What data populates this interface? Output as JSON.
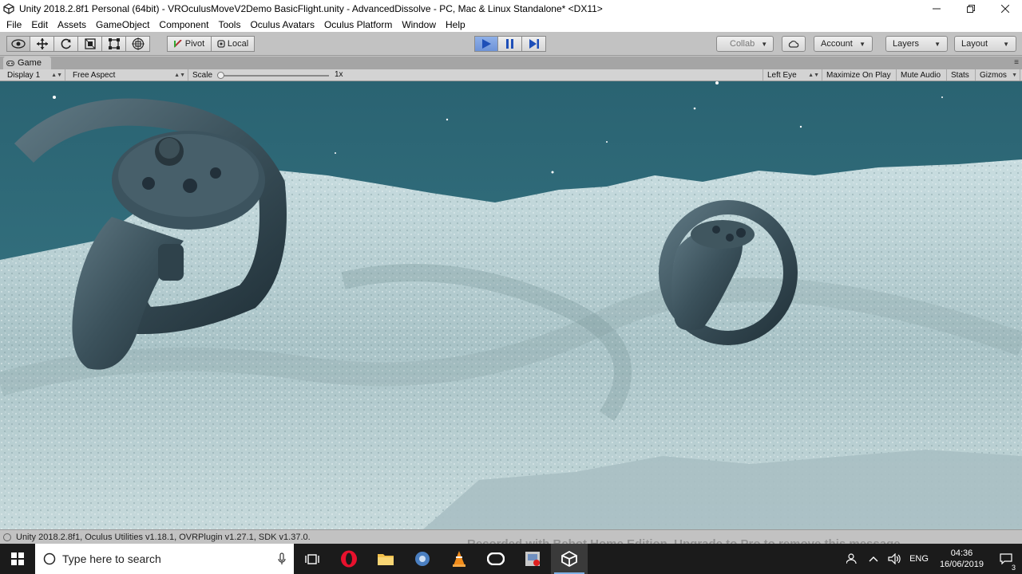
{
  "window": {
    "title": "Unity 2018.2.8f1 Personal (64bit) - VROculusMoveV2Demo BasicFlight.unity - AdvancedDissolve - PC, Mac & Linux Standalone* <DX11>"
  },
  "menu": {
    "items": [
      {
        "label": "File"
      },
      {
        "label": "Edit"
      },
      {
        "label": "Assets"
      },
      {
        "label": "GameObject"
      },
      {
        "label": "Component"
      },
      {
        "label": "Tools"
      },
      {
        "label": "Oculus Avatars"
      },
      {
        "label": "Oculus Platform"
      },
      {
        "label": "Window"
      },
      {
        "label": "Help"
      }
    ]
  },
  "toolbar": {
    "pivot_label": "Pivot",
    "local_label": "Local",
    "collab_label": "Collab",
    "account_label": "Account",
    "layers_label": "Layers",
    "layout_label": "Layout"
  },
  "game_tab": {
    "label": "Game"
  },
  "game_view": {
    "display_label": "Display 1",
    "aspect_label": "Free Aspect",
    "scale_label": "Scale",
    "scale_value": "1x",
    "scale_fraction": 0.0,
    "eye_label": "Left Eye",
    "maximize_label": "Maximize On Play",
    "mute_label": "Mute Audio",
    "stats_label": "Stats",
    "gizmos_label": "Gizmos"
  },
  "status": {
    "message": "Unity 2018.2.8f1, Oculus Utilities v1.18.1, OVRPlugin v1.27.1, SDK v1.37.0.",
    "watermark": "Recorded with Bebot Home Edition. Upgrade to Pro to remove this message"
  },
  "taskbar": {
    "search_placeholder": "Type here to search",
    "language": "ENG",
    "time": "04:36",
    "date": "16/06/2019",
    "notification_count": "3"
  },
  "colors": {
    "accent": "#6e93d8",
    "water": "#2f6674",
    "terrain": "#b9cfd3"
  }
}
